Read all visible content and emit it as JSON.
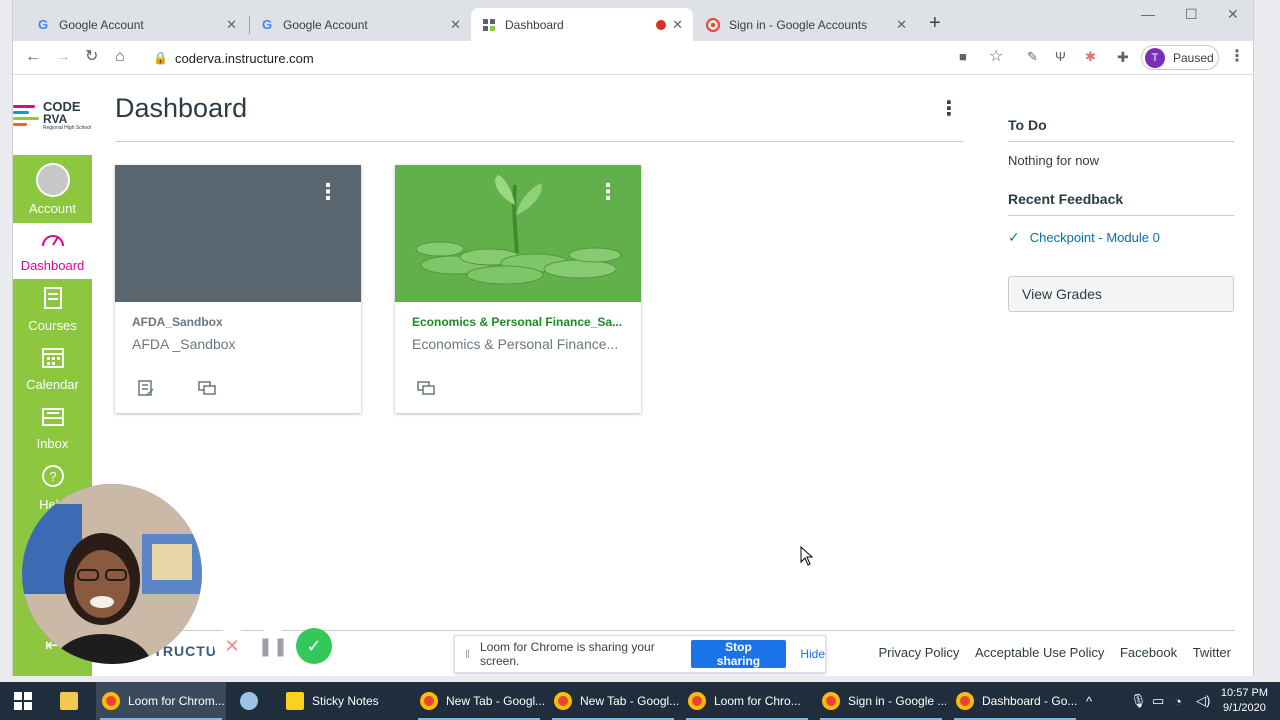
{
  "browser": {
    "tabs": [
      {
        "label": "Google Account",
        "icon": "google-g-icon",
        "active": false
      },
      {
        "label": "Google Account",
        "icon": "google-g-icon",
        "active": false
      },
      {
        "label": "Dashboard",
        "icon": "canvas-icon",
        "active": true
      },
      {
        "label": "Sign in - Google Accounts",
        "icon": "google-accounts-icon",
        "active": false
      }
    ],
    "url": "coderva.instructure.com",
    "profile_initial": "T",
    "profile_status": "Paused"
  },
  "nav": {
    "logo_line1": "CODE",
    "logo_line2": "RVA",
    "logo_line3": "Regional High School",
    "items": [
      {
        "label": "Account",
        "icon": "avatar-icon"
      },
      {
        "label": "Dashboard",
        "icon": "dashboard-icon"
      },
      {
        "label": "Courses",
        "icon": "courses-icon"
      },
      {
        "label": "Calendar",
        "icon": "calendar-icon"
      },
      {
        "label": "Inbox",
        "icon": "inbox-icon"
      },
      {
        "label": "Help",
        "icon": "help-icon"
      }
    ]
  },
  "dashboard": {
    "title": "Dashboard",
    "cards": [
      {
        "title": "AFDA_Sandbox",
        "subtitle": "AFDA _Sandbox",
        "hero_color": "#5b6770",
        "title_color": "#6b7780"
      },
      {
        "title": "Economics & Personal Finance_Sa...",
        "subtitle": "Economics & Personal Finance...",
        "hero_color": "#62b04b",
        "title_color": "#1c8b23"
      }
    ]
  },
  "sidebar": {
    "todo_heading": "To Do",
    "todo_empty": "Nothing for now",
    "feedback_heading": "Recent Feedback",
    "feedback_item": "Checkpoint - Module 0",
    "view_grades": "View Grades"
  },
  "footer": {
    "links": [
      "Privacy Policy",
      "Acceptable Use Policy",
      "Facebook",
      "Twitter"
    ],
    "brand_fragment": "STRUCTURE"
  },
  "loom": {
    "share_message": "Loom for Chrome is sharing your screen.",
    "stop_label": "Stop sharing",
    "hide_label": "Hide"
  },
  "taskbar": {
    "items": [
      {
        "label": "Loom for Chrom...",
        "open": true
      },
      {
        "label": "",
        "open": false
      },
      {
        "label": "Sticky Notes",
        "open": false
      },
      {
        "label": "New Tab - Googl...",
        "open": true
      },
      {
        "label": "New Tab - Googl...",
        "open": true
      },
      {
        "label": "Loom for Chro...",
        "open": true
      },
      {
        "label": "Sign in - Google ...",
        "open": true
      },
      {
        "label": "Dashboard - Go...",
        "open": true
      }
    ],
    "time": "10:57 PM",
    "date": "9/1/2020"
  },
  "colors": {
    "nav_green": "#8dc63f",
    "active_pink": "#d50b8b",
    "link_blue": "#0770a3",
    "stop_blue": "#1a73e8"
  }
}
